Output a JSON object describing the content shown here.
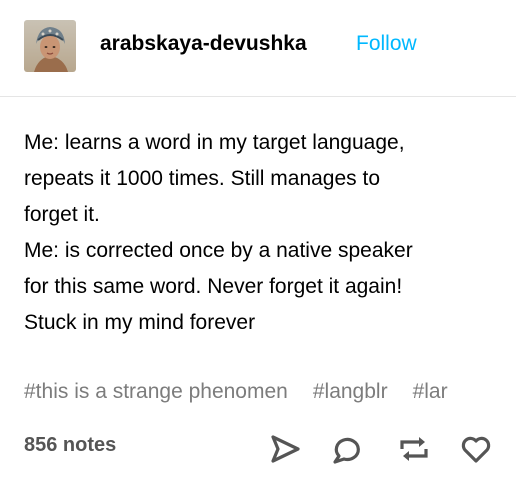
{
  "header": {
    "blog_name": "arabskaya-devushka",
    "follow_label": "Follow",
    "avatar_icon": "blog-avatar",
    "accent_color": "#00b8ff"
  },
  "post": {
    "lines": [
      "Me: learns a word in my target language,",
      "repeats it 1000 times. Still manages to",
      "forget it.",
      "Me: is corrected once by a native speaker",
      "for this same word. Never forget it again!",
      "Stuck in my mind forever"
    ]
  },
  "tags": [
    "#this is a strange phenomen",
    "#langblr",
    "#lar"
  ],
  "footer": {
    "notes_label": "856 notes",
    "actions": [
      {
        "icon": "share-icon"
      },
      {
        "icon": "reply-icon"
      },
      {
        "icon": "reblog-icon"
      },
      {
        "icon": "like-icon"
      }
    ]
  }
}
